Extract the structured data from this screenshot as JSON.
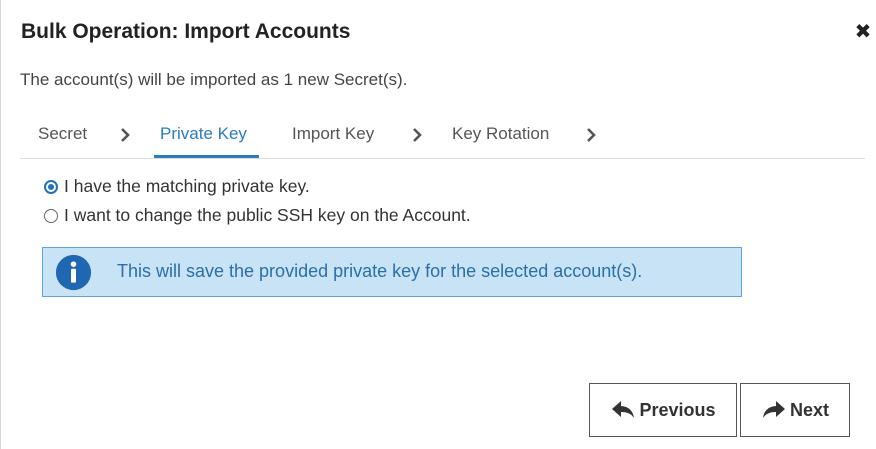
{
  "dialog": {
    "title": "Bulk Operation: Import Accounts",
    "close_glyph": "✖",
    "subtitle": "The account(s) will be imported as 1 new Secret(s)."
  },
  "tabs": [
    {
      "label": "Secret",
      "active": false
    },
    {
      "label": "Private Key",
      "active": true
    },
    {
      "label": "Import Key",
      "active": false
    },
    {
      "label": "Key Rotation",
      "active": false
    }
  ],
  "options": [
    {
      "label": "I have the matching private key.",
      "checked": true
    },
    {
      "label": "I want to change the public SSH key on the Account.",
      "checked": false
    }
  ],
  "info": {
    "text": "This will save the provided private key for the selected account(s).",
    "icon": "info-icon"
  },
  "buttons": {
    "previous_label": "Previous",
    "next_label": "Next"
  },
  "colors": {
    "accent": "#2b7bbf",
    "info_background": "#c7e3f5",
    "info_border": "#5aa7dc",
    "info_icon": "#1f66b3"
  }
}
